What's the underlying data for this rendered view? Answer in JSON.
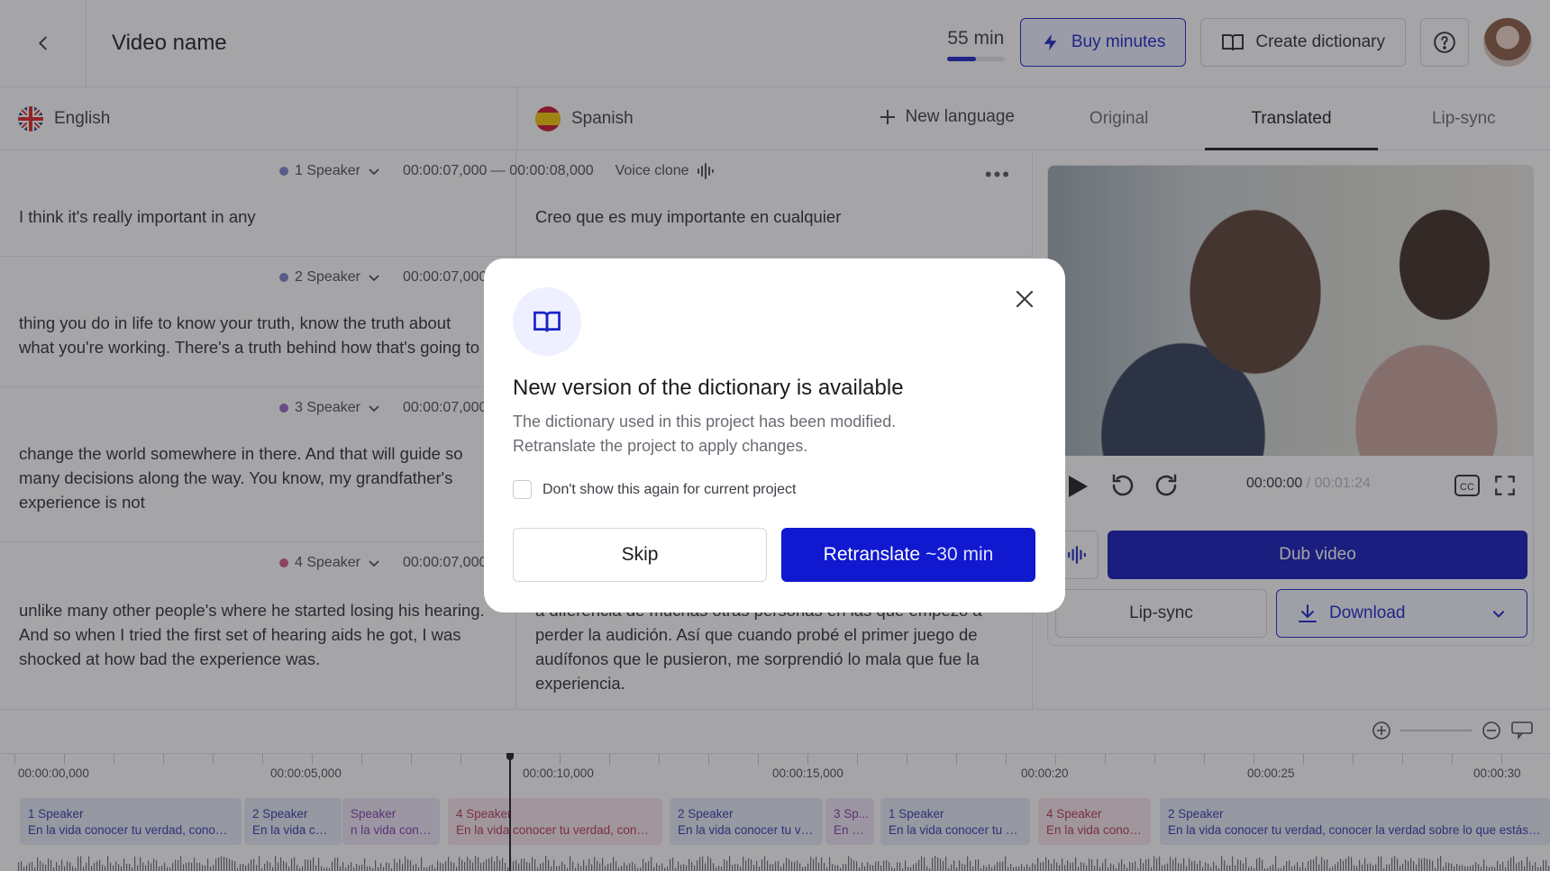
{
  "header": {
    "title": "Video name",
    "minutes_label": "55 min",
    "minutes_progress": 0.5,
    "buy_label": "Buy minutes",
    "create_dict_label": "Create dictionary"
  },
  "languages": {
    "source": "English",
    "target": "Spanish",
    "new_language": "New language"
  },
  "segments": [
    {
      "speaker": "1 Speaker",
      "color": "#7b86c9",
      "time": "00:00:07,000 — 00:00:08,000",
      "voice": "Voice clone",
      "en": "I think it's really important in any",
      "es": "Creo que es muy importante en cualquier"
    },
    {
      "speaker": "2 Speaker",
      "color": "#7b86c9",
      "time": "00:00:07,000",
      "en": "thing you do in life to know your truth, know the truth about what you're working. There's a truth behind how that's going to",
      "es": ""
    },
    {
      "speaker": "3 Speaker",
      "color": "#9a62c9",
      "time": "00:00:07,000",
      "en": "change the world somewhere in there. And that will guide so many decisions along the way. You know, my grandfather's experience is not",
      "es": ""
    },
    {
      "speaker": "4 Speaker",
      "color": "#d05c86",
      "time": "00:00:07,000",
      "en": "unlike many other people's where he started losing his hearing. And so when I tried the first set of hearing aids he got, I was shocked at how bad the experience was.",
      "es": "a diferencia de muchas otras personas en las que empezó a perder la audición. Así que cuando probé el primer juego de audífonos que le pusieron, me sorprendió lo mala que fue la experiencia."
    }
  ],
  "player": {
    "tabs": [
      "Original",
      "Translated",
      "Lip-sync"
    ],
    "active_tab": "Translated",
    "time_current": "00:00:00",
    "time_total": " / 00:01:24",
    "dub_label": "Dub video",
    "lipsync_label": "Lip-sync",
    "download_label": "Download"
  },
  "timeline": {
    "ticks": [
      "00:00:00,000",
      "00:00:05,000",
      "00:00:10,000",
      "00:00:15,000",
      "00:00:20",
      "00:00:25",
      "00:00:30"
    ],
    "clips": [
      {
        "speaker": "1 Speaker",
        "text": "En la vida conocer tu verdad, conocer la...",
        "kind": "blue"
      },
      {
        "speaker": "2 Speaker",
        "text": "En la vida con...",
        "kind": "blue"
      },
      {
        "speaker": "Speaker",
        "text": "n la vida cono...",
        "kind": "purple"
      },
      {
        "speaker": "4 Speaker",
        "text": "En la vida conocer tu verdad, conoc...",
        "kind": "pink"
      },
      {
        "speaker": "2 Speaker",
        "text": "En la vida conocer tu verdad",
        "kind": "blue"
      },
      {
        "speaker": "3 Sp...",
        "text": "En la...",
        "kind": "purple"
      },
      {
        "speaker": "1 Speaker",
        "text": "En la vida conocer tu ver...",
        "kind": "blue"
      },
      {
        "speaker": "4 Speaker",
        "text": "En la vida conoc...",
        "kind": "pink"
      },
      {
        "speaker": "2 Speaker",
        "text": "En la vida conocer tu verdad, conocer la verdad sobre lo que estás traba...",
        "kind": "blue"
      }
    ]
  },
  "modal": {
    "title": "New version of the dictionary is available",
    "description": "The dictionary used in this project has been modified. Retranslate the project to apply changes.",
    "checkbox_label": "Don't show this again for current project",
    "skip_label": "Skip",
    "retranslate_label": "Retranslate",
    "retranslate_cost": "~30 min"
  },
  "colors": {
    "accent": "#1a24c9",
    "primary_button": "#1018d0"
  }
}
